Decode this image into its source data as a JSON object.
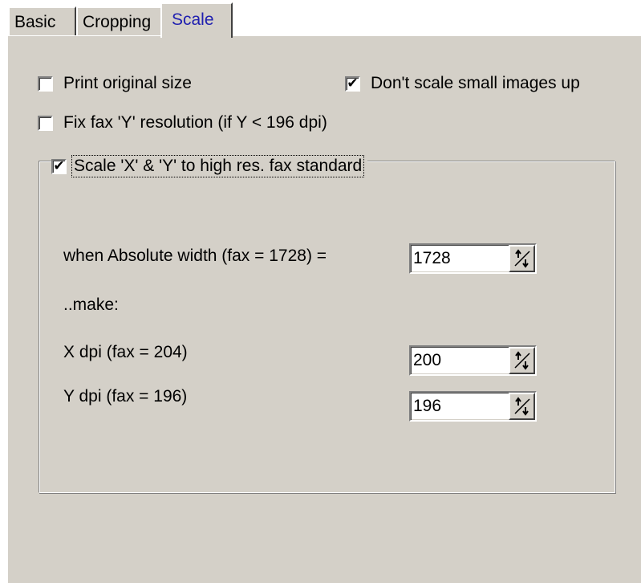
{
  "tabs": [
    {
      "label": "Basic",
      "active": false
    },
    {
      "label": "Cropping",
      "active": false
    },
    {
      "label": "Scale",
      "active": true
    }
  ],
  "options": {
    "print_original_size": {
      "label": "Print original size",
      "checked": false
    },
    "dont_scale_small_up": {
      "label": "Don't scale small images up",
      "checked": true
    },
    "fix_fax_y": {
      "label": "Fix fax 'Y' resolution (if Y < 196 dpi)",
      "checked": false
    },
    "scale_xy_fax": {
      "label": "Scale 'X' & 'Y' to high res. fax standard",
      "checked": true
    }
  },
  "group": {
    "absolute_width": {
      "label": "when Absolute width (fax = 1728) =",
      "value": "1728"
    },
    "make_label": "..make:",
    "x_dpi": {
      "label": "X dpi (fax = 204)",
      "value": "200"
    },
    "y_dpi": {
      "label": "Y dpi (fax = 196)",
      "value": "196"
    }
  },
  "check_mark": "✔",
  "icons": {
    "spin": "spin-updown-icon",
    "check": "check-icon"
  },
  "colors": {
    "face": "#d4d0c8",
    "active_tab_text": "#2020b0"
  }
}
